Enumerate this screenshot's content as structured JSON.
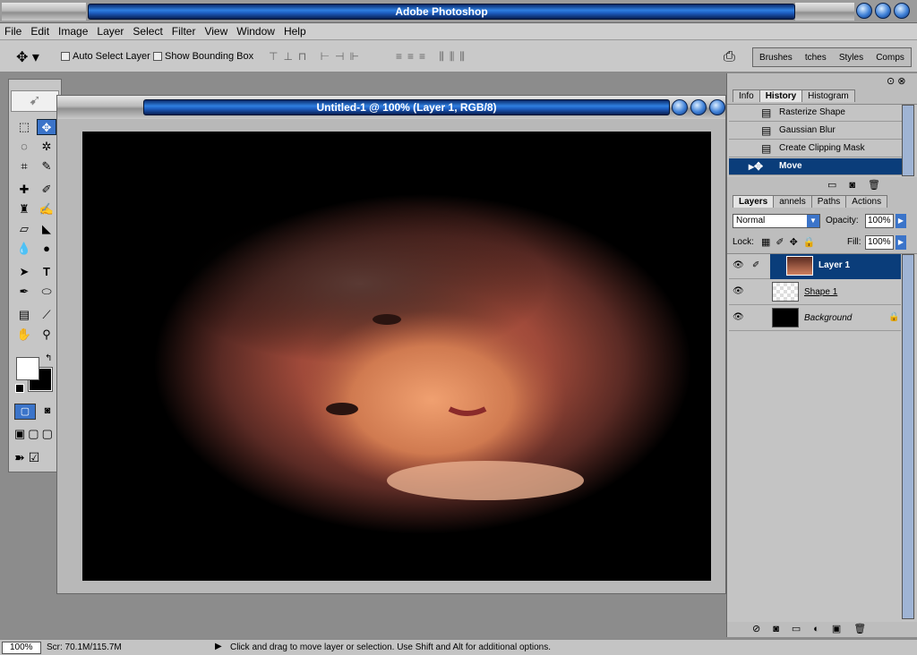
{
  "app": {
    "title": "Adobe Photoshop"
  },
  "menu": [
    "File",
    "Edit",
    "Image",
    "Layer",
    "Select",
    "Filter",
    "View",
    "Window",
    "Help"
  ],
  "options": {
    "auto_select": "Auto Select Layer",
    "show_bounding": "Show Bounding Box",
    "palette_tabs": [
      "Brushes",
      "tches",
      "Styles",
      "Comps"
    ]
  },
  "document": {
    "title": "Untitled-1 @ 100% (Layer 1, RGB/8)"
  },
  "history": {
    "tabs": [
      "Info",
      "History",
      "Histogram"
    ],
    "items": [
      "Rasterize Shape",
      "Gaussian Blur",
      "Create Clipping Mask",
      "Move"
    ]
  },
  "layers": {
    "tabs": [
      "Layers",
      "annels",
      "Paths",
      "Actions"
    ],
    "blend_mode": "Normal",
    "opacity_label": "Opacity:",
    "opacity": "100%",
    "lock_label": "Lock:",
    "fill_label": "Fill:",
    "fill": "100%",
    "items": [
      "Layer 1",
      "Shape 1",
      "Background"
    ]
  },
  "status": {
    "zoom": "100%",
    "scratch": "Scr: 70.1M/115.7M",
    "hint": "Click and drag to move layer or selection.  Use Shift and Alt for additional options."
  },
  "colors": {
    "selection_blue": "#0a3d7a",
    "titlebar_blue": "#2f7fe0"
  }
}
